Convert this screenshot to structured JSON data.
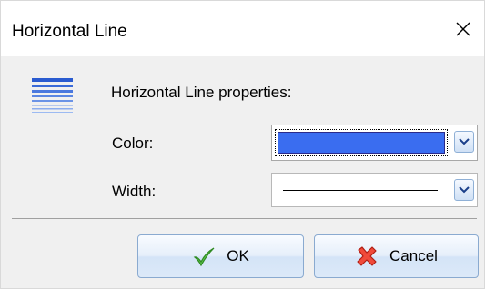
{
  "window": {
    "title": "Horizontal Line"
  },
  "content": {
    "heading": "Horizontal Line properties:",
    "color_label": "Color:",
    "width_label": "Width:",
    "color_value": "#3a6df0",
    "line_width_value": "thin"
  },
  "buttons": {
    "ok_label": "OK",
    "cancel_label": "Cancel"
  },
  "icons": {
    "dialog_icon": "horizontal-lines-icon",
    "close": "close-icon",
    "ok": "checkmark-icon",
    "cancel": "red-x-icon",
    "dropdown": "chevron-down-icon"
  },
  "colors": {
    "accent": "#3a6df0",
    "icon_blue": "#2a5bd0",
    "ok_green": "#3aa82a",
    "cancel_red": "#e0302a"
  }
}
